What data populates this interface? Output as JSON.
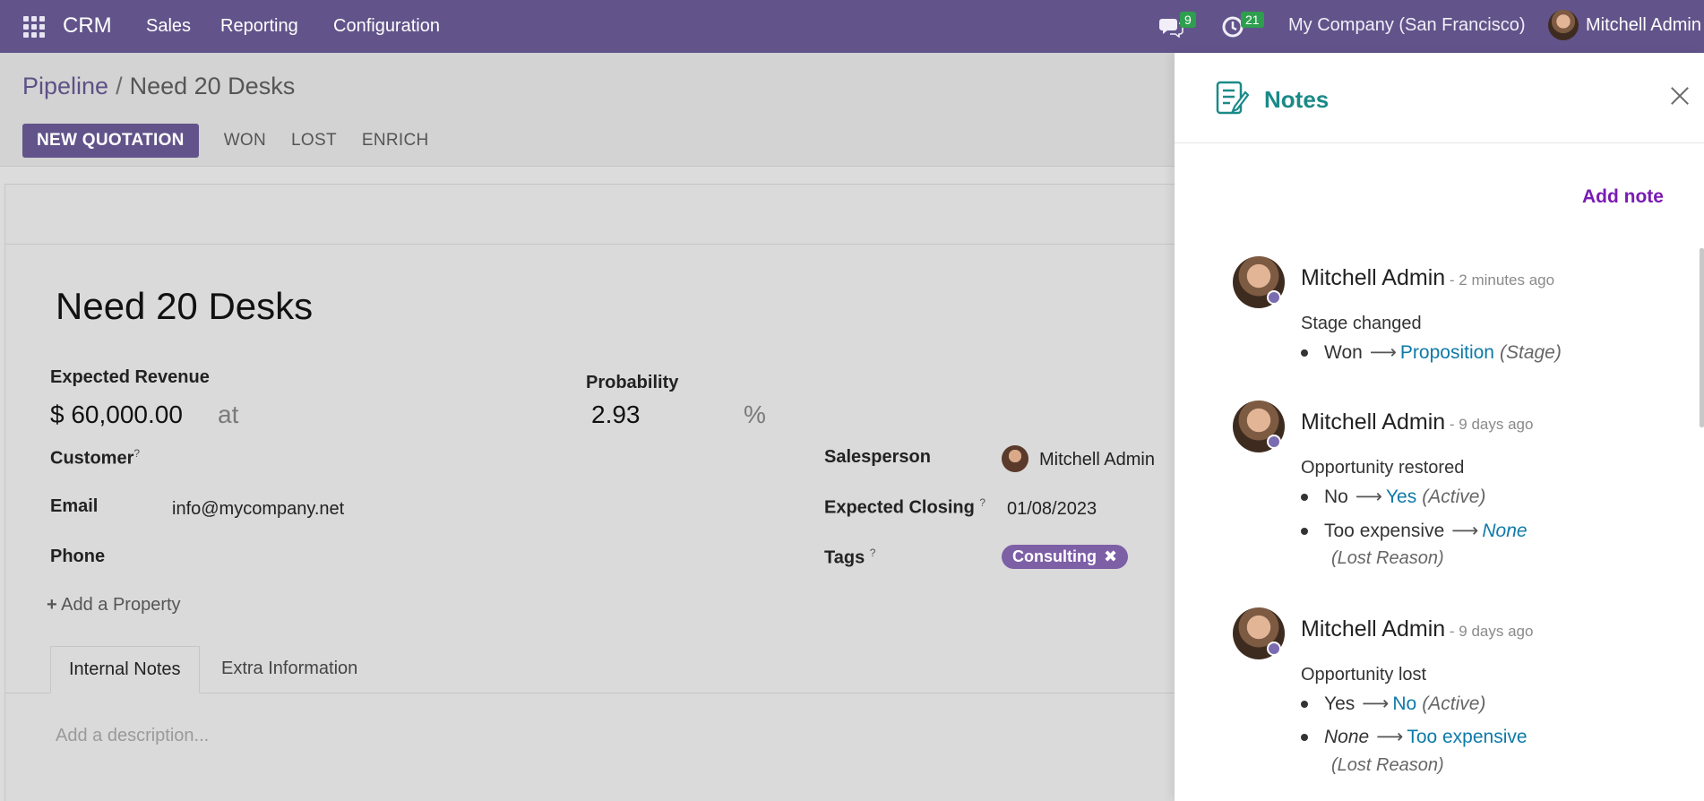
{
  "topbar": {
    "app_name": "CRM",
    "menu": [
      "Sales",
      "Reporting",
      "Configuration"
    ],
    "messages_count": "9",
    "activities_count": "21",
    "company": "My Company (San Francisco)",
    "user": "Mitchell Admin"
  },
  "breadcrumb": {
    "parent": "Pipeline",
    "separator": "/",
    "current": "Need 20 Desks"
  },
  "actions": {
    "new_quotation": "NEW QUOTATION",
    "won": "WON",
    "lost": "LOST",
    "enrich": "ENRICH"
  },
  "form": {
    "title": "Need 20 Desks",
    "expected_revenue_label": "Expected Revenue",
    "expected_revenue": "$ 60,000.00",
    "at_label": "at",
    "probability_label": "Probability",
    "probability": "2.93",
    "percent_sign": "%",
    "customer_label": "Customer",
    "help_mark": "?",
    "email_label": "Email",
    "email": "info@mycompany.net",
    "phone_label": "Phone",
    "salesperson_label": "Salesperson",
    "salesperson": "Mitchell Admin",
    "expected_closing_label": "Expected Closing",
    "expected_closing": "01/08/2023",
    "tags_label": "Tags",
    "tag": "Consulting",
    "tag_remove": "✖",
    "add_property": "Add a Property",
    "add_property_plus": "+",
    "tabs": [
      "Internal Notes",
      "Extra Information"
    ],
    "description_placeholder": "Add a description..."
  },
  "notes_panel": {
    "title": "Notes",
    "add_note": "Add note",
    "messages": [
      {
        "author": "Mitchell Admin",
        "time": " - 2 minutes ago",
        "subject": "Stage changed",
        "changes": [
          {
            "old": "Won",
            "new": "Proposition",
            "field": "(Stage)"
          }
        ]
      },
      {
        "author": "Mitchell Admin",
        "time": " - 9 days ago",
        "subject": "Opportunity restored",
        "changes": [
          {
            "old": "No",
            "new": "Yes",
            "field": "(Active)"
          },
          {
            "old": "Too expensive",
            "new": "None",
            "field": "(Lost Reason)"
          }
        ]
      },
      {
        "author": "Mitchell Admin",
        "time": " - 9 days ago",
        "subject": "Opportunity lost",
        "changes": [
          {
            "old": "Yes",
            "new": "No",
            "field": "(Active)"
          },
          {
            "old": "None",
            "new": "Too expensive",
            "field": "(Lost Reason)"
          }
        ]
      }
    ],
    "arrow": "⟶"
  },
  "colors": {
    "topbar": "#62548a",
    "primary_button": "#62548a",
    "notes_title": "#1a8a88",
    "add_note": "#7a1bb3",
    "link_value": "#0e7aa8",
    "badge": "#2e9e4f"
  }
}
